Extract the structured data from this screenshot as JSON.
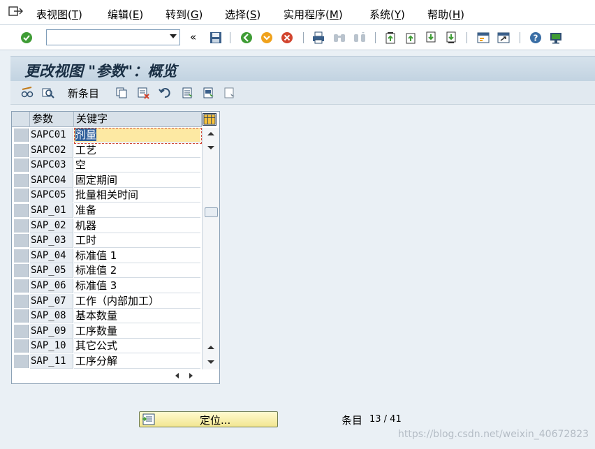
{
  "menu": [
    {
      "label": "表视图(",
      "key": "T",
      "tail": ")"
    },
    {
      "label": "编辑(",
      "key": "E",
      "tail": ")"
    },
    {
      "label": "转到(",
      "key": "G",
      "tail": ")"
    },
    {
      "label": "选择(",
      "key": "S",
      "tail": ")"
    },
    {
      "label": "实用程序(",
      "key": "M",
      "tail": ")"
    },
    {
      "label": "系统(",
      "key": "Y",
      "tail": ")"
    },
    {
      "label": "帮助(",
      "key": "H",
      "tail": ")"
    }
  ],
  "toolbar": {
    "command_field_value": "",
    "history_glyph": "«"
  },
  "title": "更改视图 \"参数\"：概览",
  "app_toolbar": {
    "new_entries_label": "新条目"
  },
  "table": {
    "headers": {
      "param": "参数",
      "keyword": "关键字"
    },
    "rows": [
      {
        "param": "SAPC01",
        "keyword": "剂量"
      },
      {
        "param": "SAPC02",
        "keyword": "工艺"
      },
      {
        "param": "SAPC03",
        "keyword": "空"
      },
      {
        "param": "SAPC04",
        "keyword": "固定期间"
      },
      {
        "param": "SAPC05",
        "keyword": "批量相关时间"
      },
      {
        "param": "SAP_01",
        "keyword": "准备"
      },
      {
        "param": "SAP_02",
        "keyword": "机器"
      },
      {
        "param": "SAP_03",
        "keyword": "工时"
      },
      {
        "param": "SAP_04",
        "keyword": "标准值 1"
      },
      {
        "param": "SAP_05",
        "keyword": "标准值 2"
      },
      {
        "param": "SAP_06",
        "keyword": "标准值 3"
      },
      {
        "param": "SAP_07",
        "keyword": "工作（内部加工）"
      },
      {
        "param": "SAP_08",
        "keyword": "基本数量"
      },
      {
        "param": "SAP_09",
        "keyword": "工序数量"
      },
      {
        "param": "SAP_10",
        "keyword": "其它公式"
      },
      {
        "param": "SAP_11",
        "keyword": "工序分解"
      }
    ]
  },
  "bottom": {
    "position_label": "定位...",
    "entry_label": "条目",
    "entry_count": "13 / 41"
  },
  "watermark": "https://blog.csdn.net/weixin_40672823",
  "colors": {
    "accent_title": "#1a2f44",
    "active_cell": "#fde9a3",
    "selection": "#2d5d9a"
  }
}
